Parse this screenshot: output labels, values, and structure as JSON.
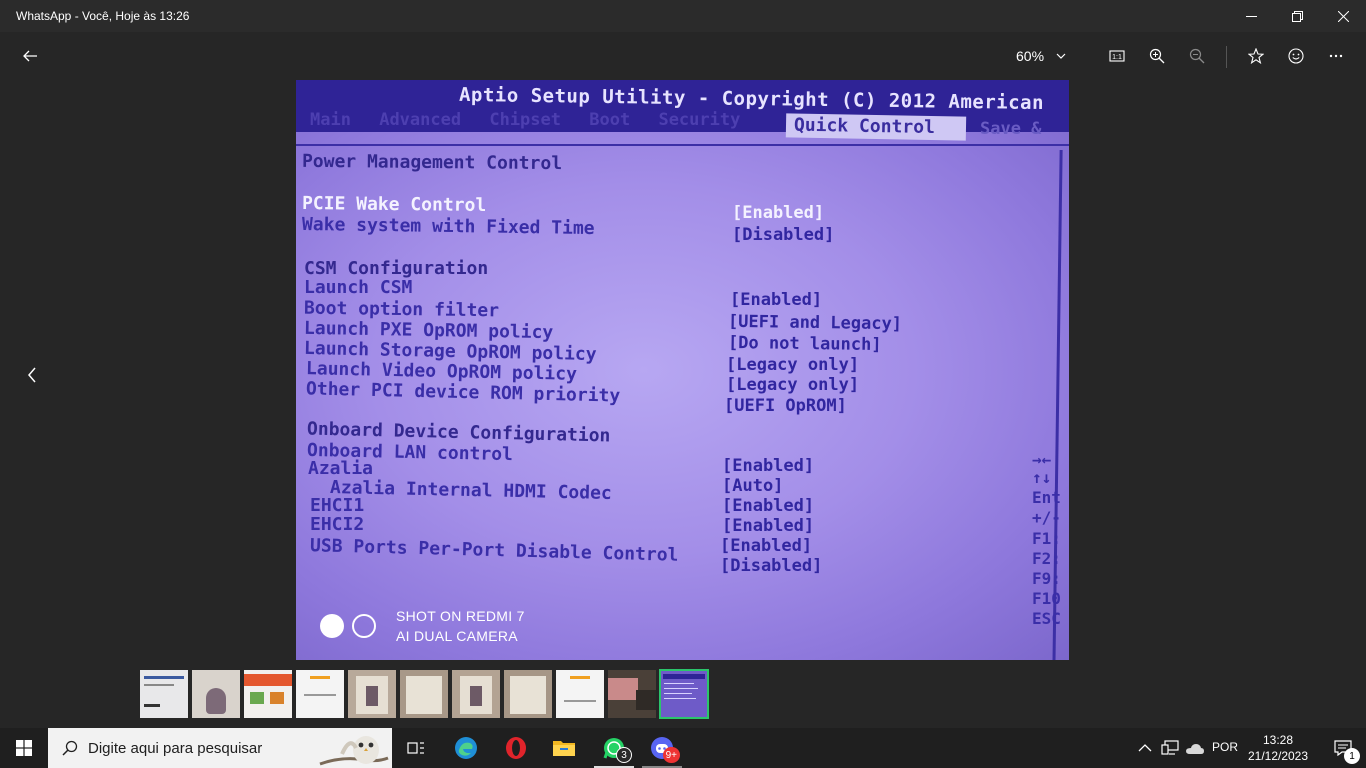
{
  "window": {
    "title": "WhatsApp - Você, Hoje às 13:26",
    "minimize_icon": "minimize-icon",
    "restore_icon": "restore-icon",
    "close_icon": "close-icon"
  },
  "toolbar": {
    "back_icon": "back-arrow-icon",
    "zoom_level": "60%",
    "actual_size_label": "1:1"
  },
  "photo": {
    "bios_title": "Aptio Setup Utility - Copyright (C) 2012 American",
    "tabs": [
      "Main",
      "Advanced",
      "Chipset",
      "Boot",
      "Security"
    ],
    "active_tab": "Quick Control",
    "last_tab": "Save &",
    "section_title": "Power Management Control",
    "rows": [
      {
        "label": "PCIE Wake Control",
        "value": "[Enabled]"
      },
      {
        "label": "Wake system with Fixed Time",
        "value": "[Disabled]"
      },
      {
        "label": "CSM Configuration",
        "value": ""
      },
      {
        "label": "Launch CSM",
        "value": "[Enabled]"
      },
      {
        "label": "Boot option filter",
        "value": "[UEFI and Legacy]"
      },
      {
        "label": "Launch PXE OpROM policy",
        "value": "[Do not launch]"
      },
      {
        "label": "Launch Storage OpROM policy",
        "value": "[Legacy only]"
      },
      {
        "label": "Launch Video OpROM policy",
        "value": "[Legacy only]"
      },
      {
        "label": "Other PCI device ROM priority",
        "value": "[UEFI OpROM]"
      },
      {
        "label": "Onboard Device Configuration",
        "value": ""
      },
      {
        "label": "Onboard LAN control",
        "value": "[Enabled]"
      },
      {
        "label": "Azalia",
        "value": "[Auto]"
      },
      {
        "label": "Azalia Internal HDMI Codec",
        "value": "[Enabled]"
      },
      {
        "label": "EHCI1",
        "value": "[Enabled]"
      },
      {
        "label": "EHCI2",
        "value": "[Enabled]"
      },
      {
        "label": "USB Ports Per-Port Disable Control",
        "value": "[Disabled]"
      }
    ],
    "help_keys": [
      "→←",
      "↑↓",
      "Ent",
      "+/-",
      "F1:",
      "F2:",
      "F9:",
      "F10",
      "ESC"
    ],
    "watermark_line1": "SHOT ON REDMI 7",
    "watermark_line2": "AI DUAL CAMERA"
  },
  "filmstrip": {
    "thumbnail_count": 11,
    "selected_index": 10
  },
  "taskbar": {
    "search_placeholder": "Digite aqui para pesquisar",
    "whatsapp_badge": "3",
    "discord_badge": "9+",
    "language": "POR",
    "time": "13:28",
    "date": "21/12/2023",
    "notification_count": "1",
    "colors": {
      "accent_green": "#2bc56b",
      "whatsapp": "#25d366",
      "edge": "#1f8fd6",
      "opera": "#e0242b",
      "explorer": "#f2b721",
      "discord": "#5865f2"
    }
  }
}
